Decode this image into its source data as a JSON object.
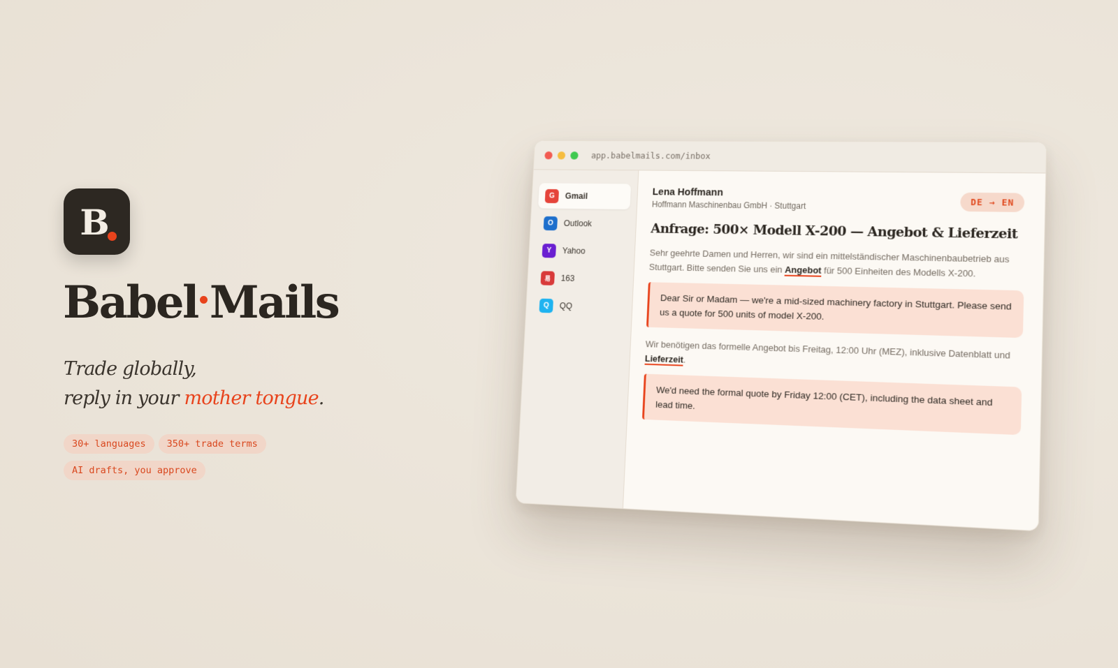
{
  "hero": {
    "icon_letter": "B",
    "brand_part1": "Babel",
    "brand_part2": "Mails",
    "tagline_line1": "Trade globally,",
    "tagline_line2_prefix": "reply in your ",
    "tagline_accent": "mother tongue",
    "tagline_suffix": ".",
    "pills": [
      "30+ languages",
      "350+ trade terms",
      "AI drafts, you approve"
    ],
    "accent_color": "#e8431c"
  },
  "window": {
    "url": "app.babelmails.com/inbox"
  },
  "sidebar": {
    "accounts": [
      {
        "label": "Gmail",
        "badge": "G",
        "color": "#e5443a"
      },
      {
        "label": "Outlook",
        "badge": "O",
        "color": "#1e6fcc"
      },
      {
        "label": "Yahoo",
        "badge": "Y",
        "color": "#6a1fd1"
      },
      {
        "label": "163",
        "badge": "易",
        "color": "#d83a3a"
      },
      {
        "label": "QQ",
        "badge": "Q",
        "color": "#1fb3f0"
      }
    ]
  },
  "mail": {
    "sender": "Lena Hoffmann",
    "company": "Hoffmann Maschinenbau GmbH · Stuttgart",
    "lang": "DE → EN",
    "subject": "Anfrage: 500× Modell X-200 — Angebot & Lieferzeit",
    "p1_before": "Sehr geehrte Damen und Herren, wir sind ein mittelständischer Maschinenbaubetrieb aus Stuttgart. Bitte senden Sie uns ein ",
    "p1_kw": "Angebot",
    "p1_after": " für 500 Einheiten des Modells X-200.",
    "t1": "Dear Sir or Madam — we're a mid-sized machinery factory in Stuttgart. Please send us a quote for 500 units of model X-200.",
    "p2_before": "Wir benötigen das formelle Angebot bis Freitag, 12:00 Uhr (MEZ), inklusive Datenblatt und ",
    "p2_kw": "Lieferzeit",
    "p2_after": ".",
    "t2": "We'd need the formal quote by Friday 12:00 (CET), including the data sheet and lead time."
  }
}
